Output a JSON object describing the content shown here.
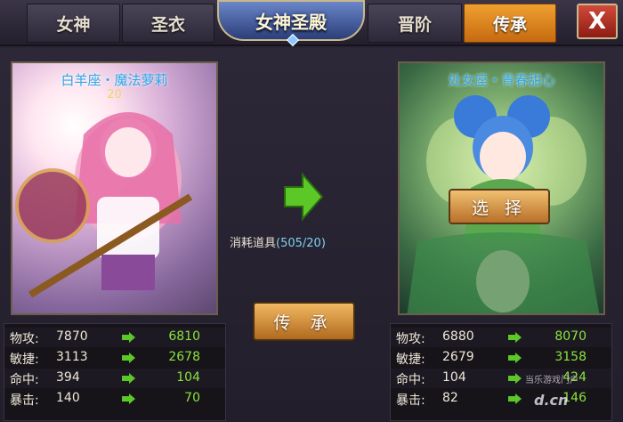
{
  "tabs": [
    {
      "label": "女神",
      "active": false
    },
    {
      "label": "圣衣",
      "active": false
    },
    {
      "label": "晋阶",
      "active": false
    },
    {
      "label": "传承",
      "active": true
    }
  ],
  "title": "女神圣殿",
  "close_label": "X",
  "left_card": {
    "name": "白羊座・魔法萝莉",
    "level": "20"
  },
  "right_card": {
    "name": "处女座・青春甜心",
    "select_label": "选 择"
  },
  "consume": {
    "label": "消耗道具",
    "count": "(505/20)"
  },
  "inherit_label": "传 承",
  "left_stats": [
    {
      "label": "物攻:",
      "old": "7870",
      "new": "6810"
    },
    {
      "label": "敏捷:",
      "old": "3113",
      "new": "2678"
    },
    {
      "label": "命中:",
      "old": "394",
      "new": "104"
    },
    {
      "label": "暴击:",
      "old": "140",
      "new": "70"
    }
  ],
  "right_stats": [
    {
      "label": "物攻:",
      "old": "6880",
      "new": "8070"
    },
    {
      "label": "敏捷:",
      "old": "2679",
      "new": "3158"
    },
    {
      "label": "命中:",
      "old": "104",
      "new": "424"
    },
    {
      "label": "暴击:",
      "old": "82",
      "new": "146"
    }
  ],
  "watermark": {
    "line1": "当乐游戏门户",
    "line2": "d.cn"
  },
  "colors": {
    "accent_orange": "#e08a20",
    "stat_new_green": "#8ae43c",
    "card_name_blue": "#2aa8e8"
  }
}
